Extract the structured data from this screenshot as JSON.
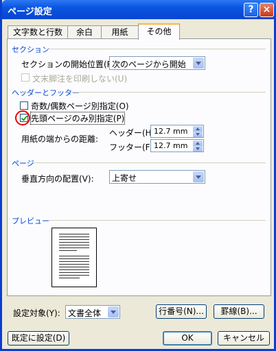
{
  "window": {
    "title": "ページ設定",
    "help": "?",
    "close": "×"
  },
  "tabs": [
    "文字数と行数",
    "余白",
    "用紙",
    "その他"
  ],
  "section": {
    "heading": "セクション",
    "start_label": "セクションの開始位置(R):",
    "start_value": "次のページから開始",
    "suppress_endnotes": "文末脚注を印刷しない(U)"
  },
  "header_footer": {
    "heading": "ヘッダーとフッター",
    "odd_even": "奇数/偶数ページ別指定(O)",
    "first_page": "先頭ページのみ別指定(P)",
    "distance_label": "用紙の端からの距離:",
    "header_label": "ヘッダー(H):",
    "header_value": "12.7 mm",
    "footer_label": "フッター(F):",
    "footer_value": "12.7 mm",
    "odd_even_checked": false,
    "first_page_checked": true
  },
  "page": {
    "heading": "ページ",
    "valign_label": "垂直方向の配置(V):",
    "valign_value": "上寄せ"
  },
  "preview": {
    "heading": "プレビュー"
  },
  "apply": {
    "label": "設定対象(Y):",
    "value": "文書全体",
    "line_numbers": "行番号(N)...",
    "borders": "罫線(B)..."
  },
  "buttons": {
    "default": "既定に設定(D)",
    "ok": "OK",
    "cancel": "キャンセル"
  }
}
